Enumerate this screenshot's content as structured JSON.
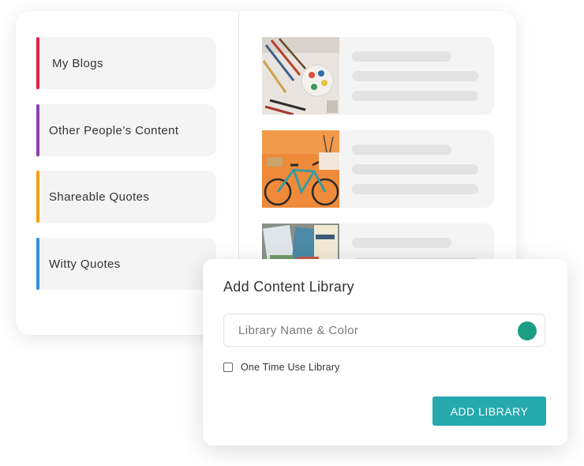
{
  "libraries": [
    {
      "label": "My Blogs",
      "color": "#e0234b"
    },
    {
      "label": "Other People’s Content",
      "color": "#8a3fb3"
    },
    {
      "label": "Shareable Quotes",
      "color": "#f5a012"
    },
    {
      "label": "Witty Quotes",
      "color": "#3493dc"
    }
  ],
  "content_items": [
    {
      "image": "art-supplies-photo"
    },
    {
      "image": "bicycle-photo"
    },
    {
      "image": "magazines-photo"
    }
  ],
  "modal": {
    "title": "Add Content Library",
    "name_placeholder": "Library Name & Color",
    "selected_color": "#1b9e84",
    "checkbox_label": "One Time Use Library",
    "checkbox_checked": false,
    "add_button_label": "ADD LIBRARY",
    "button_color": "#25a8ae"
  }
}
